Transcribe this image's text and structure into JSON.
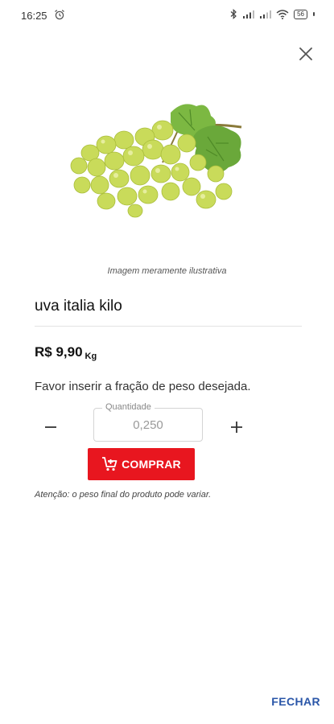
{
  "status_bar": {
    "time": "16:25",
    "battery": "56"
  },
  "product": {
    "image_caption": "Imagem meramente ilustrativa",
    "name": "uva italia kilo",
    "price": "R$ 9,90",
    "price_unit": "Kg"
  },
  "quantity": {
    "instruction": "Favor inserir a fração de peso desejada.",
    "label": "Quantidade",
    "value": "0,250"
  },
  "actions": {
    "buy_label": "COMPRAR",
    "close_label": "FECHAR"
  },
  "warning": "Atenção: o peso final do produto pode variar.",
  "colors": {
    "accent": "#e8161f",
    "link": "#2a56a8",
    "grape": "#c9db5a",
    "leaf": "#6aa83a"
  }
}
